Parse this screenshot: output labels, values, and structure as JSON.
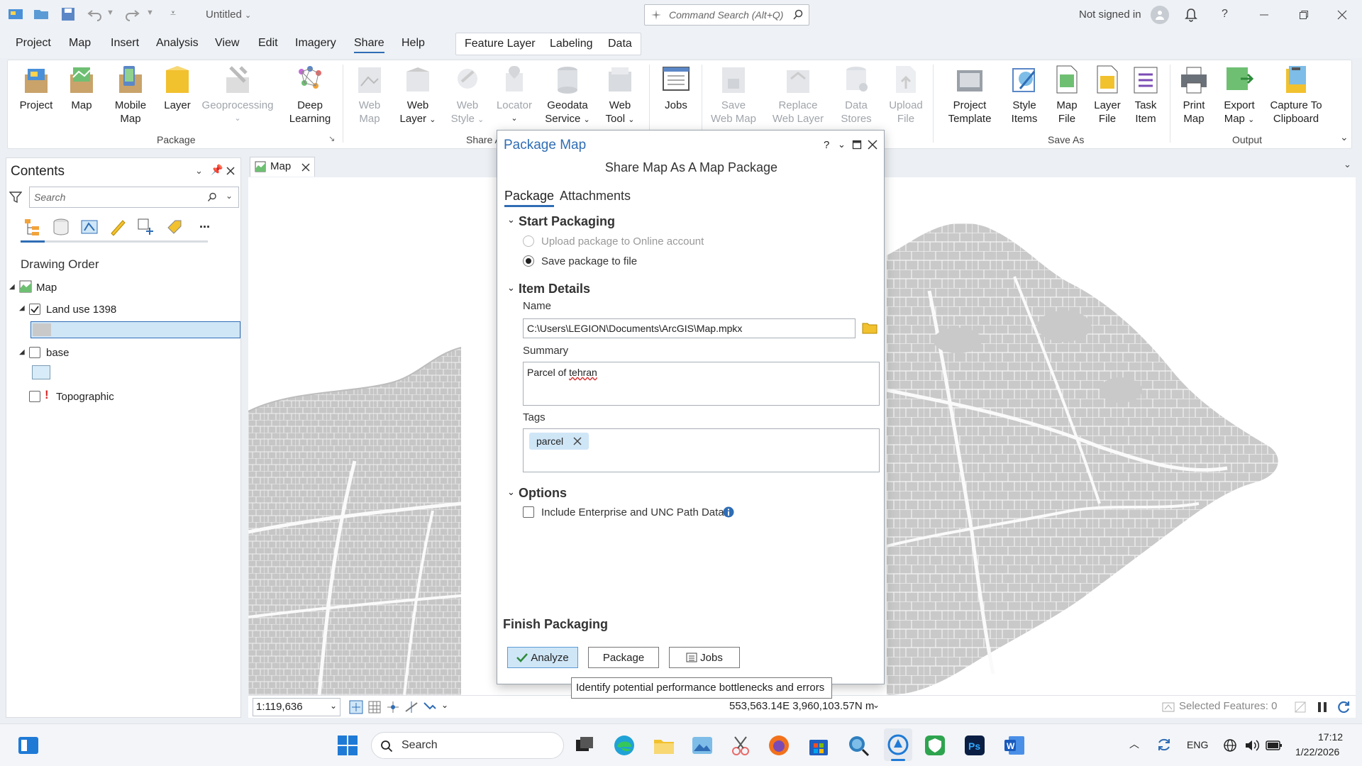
{
  "titlebar": {
    "document_title": "Untitled",
    "command_search_placeholder": "Command Search (Alt+Q)",
    "not_signed_in": "Not signed in",
    "help": "?"
  },
  "menu": {
    "items": [
      "Project",
      "Map",
      "Insert",
      "Analysis",
      "View",
      "Edit",
      "Imagery",
      "Share",
      "Help"
    ],
    "active": "Share",
    "context_tabs": [
      "Feature Layer",
      "Labeling",
      "Data"
    ]
  },
  "ribbon": {
    "package_group": "Package",
    "share_as_group": "Share A",
    "save_as_group": "Save As",
    "output_group": "Output",
    "buttons": {
      "project": "Project",
      "map": "Map",
      "mobile_map_1": "Mobile",
      "mobile_map_2": "Map",
      "layer": "Layer",
      "geoprocessing": "Geoprocessing",
      "deep_learning_1": "Deep",
      "deep_learning_2": "Learning",
      "web_map_1": "Web",
      "web_map_2": "Map",
      "web_layer_1": "Web",
      "web_layer_2": "Layer",
      "web_style_1": "Web",
      "web_style_2": "Style",
      "locator": "Locator",
      "geodata_service_1": "Geodata",
      "geodata_service_2": "Service",
      "web_tool_1": "Web",
      "web_tool_2": "Tool",
      "jobs": "Jobs",
      "save_web_map_1": "Save",
      "save_web_map_2": "Web Map",
      "replace_web_layer_1": "Replace",
      "replace_web_layer_2": "Web Layer",
      "data_stores_1": "Data",
      "data_stores_2": "Stores",
      "upload_file_1": "Upload",
      "upload_file_2": "File",
      "project_template_1": "Project",
      "project_template_2": "Template",
      "style_items_1": "Style",
      "style_items_2": "Items",
      "map_file_1": "Map",
      "map_file_2": "File",
      "layer_file_1": "Layer",
      "layer_file_2": "File",
      "task_item_1": "Task",
      "task_item_2": "Item",
      "print_map_1": "Print",
      "print_map_2": "Map",
      "export_map_1": "Export",
      "export_map_2": "Map",
      "capture_1": "Capture To",
      "capture_2": "Clipboard"
    }
  },
  "contents": {
    "title": "Contents",
    "search_placeholder": "Search",
    "more": "...",
    "drawing_order": "Drawing Order",
    "tree": {
      "map": "Map",
      "land_use": "Land use 1398",
      "base": "base",
      "topographic": "Topographic",
      "warning": "!"
    }
  },
  "map_view": {
    "tab_label": "Map",
    "scale": "1:119,636",
    "coordinates": "553,563.14E 3,960,103.57N m",
    "selected_features": "Selected Features: 0"
  },
  "dialog": {
    "title": "Package Map",
    "help": "?",
    "subtitle": "Share Map As A Map Package",
    "tabs": [
      "Package",
      "Attachments"
    ],
    "active_tab": "Package",
    "start_packaging": {
      "title": "Start Packaging",
      "upload_option": "Upload package to Online account",
      "save_option": "Save package to file",
      "selected": "save"
    },
    "item_details": {
      "title": "Item Details",
      "name_label": "Name",
      "name_value": "C:\\Users\\LEGION\\Documents\\ArcGIS\\Map.mpkx",
      "summary_label": "Summary",
      "summary_value_prefix": "Parcel of ",
      "summary_value_word": "tehran",
      "tags_label": "Tags",
      "tags": [
        "parcel"
      ]
    },
    "options": {
      "title": "Options",
      "include_unc": "Include Enterprise and UNC Path Data",
      "include_unc_checked": false
    },
    "finish": {
      "title": "Finish Packaging",
      "analyze": "Analyze",
      "package": "Package",
      "jobs": "Jobs"
    },
    "tooltip": "Identify potential performance bottlenecks and errors"
  },
  "taskbar": {
    "search_placeholder": "Search",
    "language": "ENG",
    "time": "17:12",
    "date": "1/22/2026"
  },
  "colors": {
    "accent_blue": "#2f6db5",
    "selected_row": "#cfe6f7",
    "map_gray": "#c9c9c9"
  }
}
